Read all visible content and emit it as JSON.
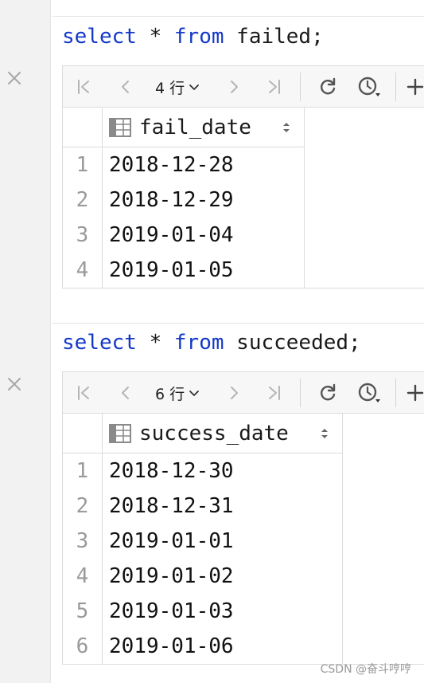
{
  "queries": [
    {
      "sql": {
        "kw1": "select",
        "rest1": " * ",
        "kw2": "from",
        "rest2": " failed;"
      },
      "toolbar": {
        "row_count": "4 行"
      },
      "column": "fail_date",
      "rows": [
        {
          "num": "1",
          "value": "2018-12-28"
        },
        {
          "num": "2",
          "value": "2018-12-29"
        },
        {
          "num": "3",
          "value": "2019-01-04"
        },
        {
          "num": "4",
          "value": "2019-01-05"
        }
      ]
    },
    {
      "sql": {
        "kw1": "select",
        "rest1": " * ",
        "kw2": "from",
        "rest2": " succeeded;"
      },
      "toolbar": {
        "row_count": "6 行"
      },
      "column": "success_date",
      "rows": [
        {
          "num": "1",
          "value": "2018-12-30"
        },
        {
          "num": "2",
          "value": "2018-12-31"
        },
        {
          "num": "3",
          "value": "2019-01-01"
        },
        {
          "num": "4",
          "value": "2019-01-02"
        },
        {
          "num": "5",
          "value": "2019-01-03"
        },
        {
          "num": "6",
          "value": "2019-01-06"
        }
      ]
    }
  ],
  "icons": [
    "close-icon",
    "first-page-icon",
    "prev-page-icon",
    "chevron-down-icon",
    "next-page-icon",
    "last-page-icon",
    "refresh-icon",
    "history-icon",
    "add-row-icon",
    "table-icon",
    "sort-icon"
  ],
  "colors": {
    "keyword": "#1338c8",
    "gutter": "#f2f2f2",
    "toolbar": "#f7f7f7"
  },
  "watermark": "CSDN @奋斗哼哼"
}
